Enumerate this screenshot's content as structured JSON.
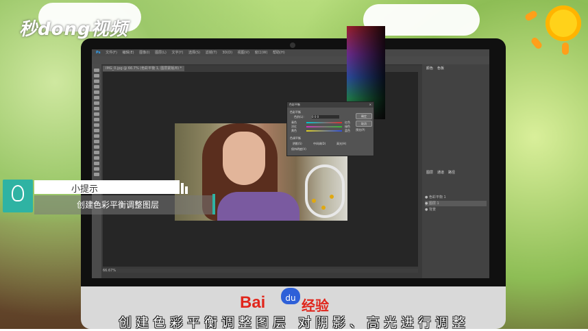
{
  "watermark": "秒dong视频",
  "photoshop": {
    "menu": [
      "文件(F)",
      "编辑(E)",
      "图像(I)",
      "图层(L)",
      "文字(Y)",
      "选择(S)",
      "滤镜(T)",
      "3D(D)",
      "视图(V)",
      "窗口(W)",
      "帮助(H)"
    ],
    "doc_tab": "IMG_0.jpg @ 66.7% (色彩平衡 1, 图层蒙版/8) *",
    "status": "66.67%",
    "panels": {
      "color_tab": "颜色",
      "swatches_tab": "色板",
      "layers_tab": "图层",
      "channels_tab": "通道",
      "paths_tab": "路径"
    },
    "layers": [
      "色彩平衡 1",
      "图层 1",
      "背景"
    ]
  },
  "dialog": {
    "title": "色彩平衡",
    "balance_label": "色彩平衡",
    "levels_label": "色阶(L):",
    "levels": [
      "0",
      "0",
      "0"
    ],
    "rows": [
      {
        "left": "青色",
        "right": "红色"
      },
      {
        "left": "洋红",
        "right": "绿色"
      },
      {
        "left": "黄色",
        "right": "蓝色"
      }
    ],
    "tone_label": "色调平衡",
    "tones": [
      "阴影(S)",
      "中间调(D)",
      "高光(H)"
    ],
    "preserve": "保持明度(V)",
    "ok": "确定",
    "cancel": "取消",
    "preview": "预览(P)"
  },
  "tip": {
    "title": "小提示",
    "text": "创建色彩平衡调整图层"
  },
  "brand": {
    "bai": "Bai",
    "du": "du",
    "jingyan": "经验"
  },
  "subtitle": "创建色彩平衡调整图层 对阴影、高光进行调整"
}
